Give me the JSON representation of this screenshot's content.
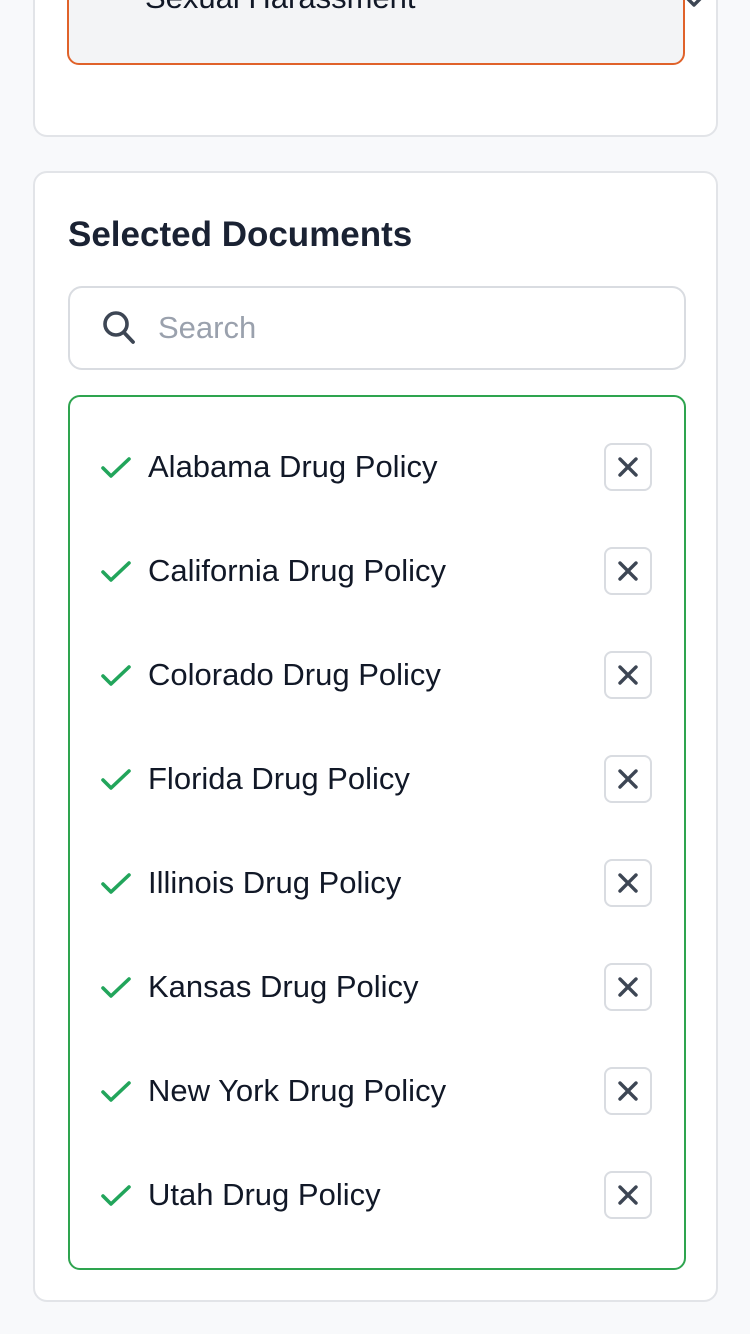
{
  "category_select": {
    "value": "Sexual Harassment",
    "icon": "chevron-down-icon"
  },
  "selected_documents": {
    "title": "Selected Documents",
    "search": {
      "placeholder": "Search",
      "value": "",
      "icon": "search-icon"
    },
    "items": [
      {
        "label": "Alabama Drug Policy",
        "selected": true
      },
      {
        "label": "California Drug Policy",
        "selected": true
      },
      {
        "label": "Colorado Drug Policy",
        "selected": true
      },
      {
        "label": "Florida Drug Policy",
        "selected": true
      },
      {
        "label": "Illinois Drug Policy",
        "selected": true
      },
      {
        "label": "Kansas Drug Policy",
        "selected": true
      },
      {
        "label": "New York Drug Policy",
        "selected": true
      },
      {
        "label": "Utah Drug Policy",
        "selected": true
      }
    ]
  },
  "colors": {
    "select_border": "#e0622a",
    "list_border": "#2ea44f",
    "check": "#22a55b",
    "remove_icon": "#3d4654"
  }
}
